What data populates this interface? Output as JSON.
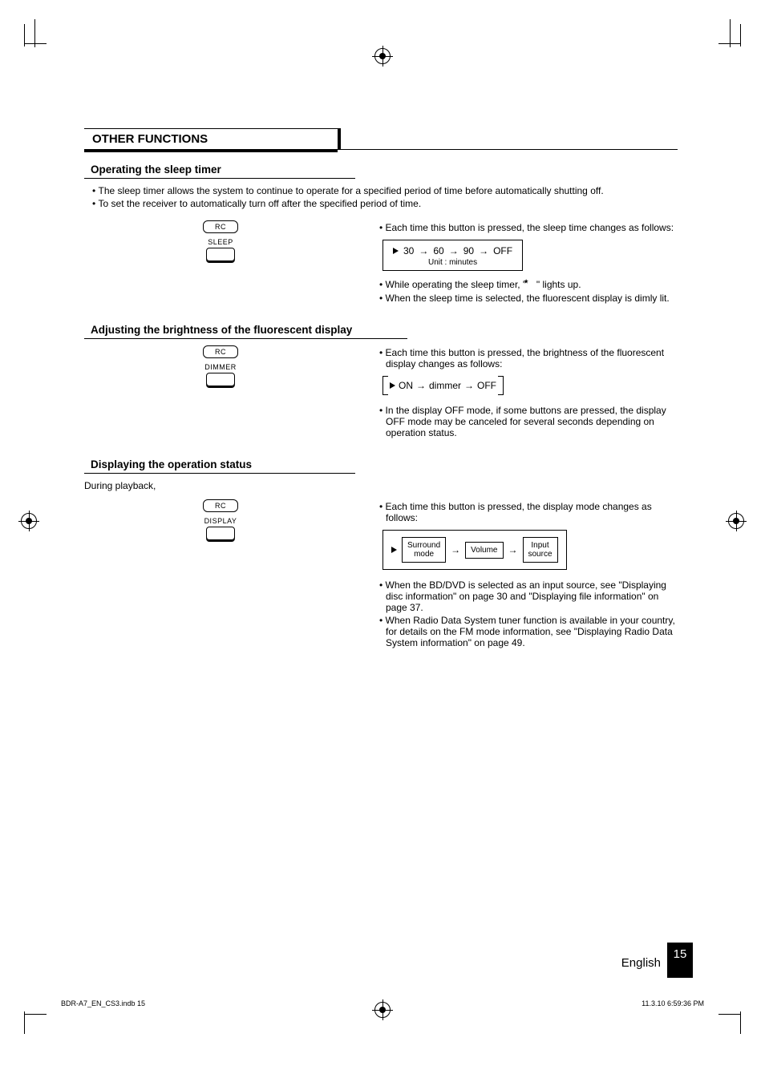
{
  "section_title": "OTHER FUNCTIONS",
  "sleep": {
    "heading": "Operating the sleep timer",
    "intro1": "• The sleep timer allows the system to continue to operate for a specified period of time before automatically shutting off.",
    "intro2": "• To set the receiver to automatically turn off after the specified period of time.",
    "rc": "RC",
    "btn": "SLEEP",
    "note1": "• Each time this button is pressed, the sleep time changes as follows:",
    "cycle": {
      "v1": "30",
      "v2": "60",
      "v3": "90",
      "v4": "OFF",
      "unit": "Unit : minutes"
    },
    "note2a": "• While operating the sleep timer, \"",
    "note2b": "\" lights up.",
    "note3": "• When the sleep time is selected, the fluorescent display is dimly lit."
  },
  "dimmer": {
    "heading": "Adjusting the brightness of the fluorescent display",
    "rc": "RC",
    "btn": "DIMMER",
    "note1": "• Each time this button is pressed, the brightness of the fluorescent display changes as follows:",
    "cycle": {
      "v1": "ON",
      "v2": "dimmer",
      "v3": "OFF"
    },
    "note2": "• In the display OFF mode, if some buttons are pressed, the display OFF mode may be canceled for several seconds depending on operation status."
  },
  "display": {
    "heading": "Displaying the operation status",
    "pre": "During playback,",
    "rc": "RC",
    "btn": "DISPLAY",
    "note1": "• Each time this button is pressed, the display mode changes as follows:",
    "boxes": {
      "b1a": "Surround",
      "b1b": "mode",
      "b2": "Volume",
      "b3a": "Input",
      "b3b": "source"
    },
    "note2": "• When the BD/DVD is selected as an input source, see \"Displaying disc information\" on page 30 and \"Displaying file information\" on page 37.",
    "note3": "• When Radio Data System tuner function is available in your country, for details on the FM mode information, see \"Displaying Radio Data System information\" on page 49."
  },
  "footer": {
    "lang": "English",
    "page": "15",
    "file": "BDR-A7_EN_CS3.indb   15",
    "timestamp": "11.3.10   6:59:36 PM"
  }
}
